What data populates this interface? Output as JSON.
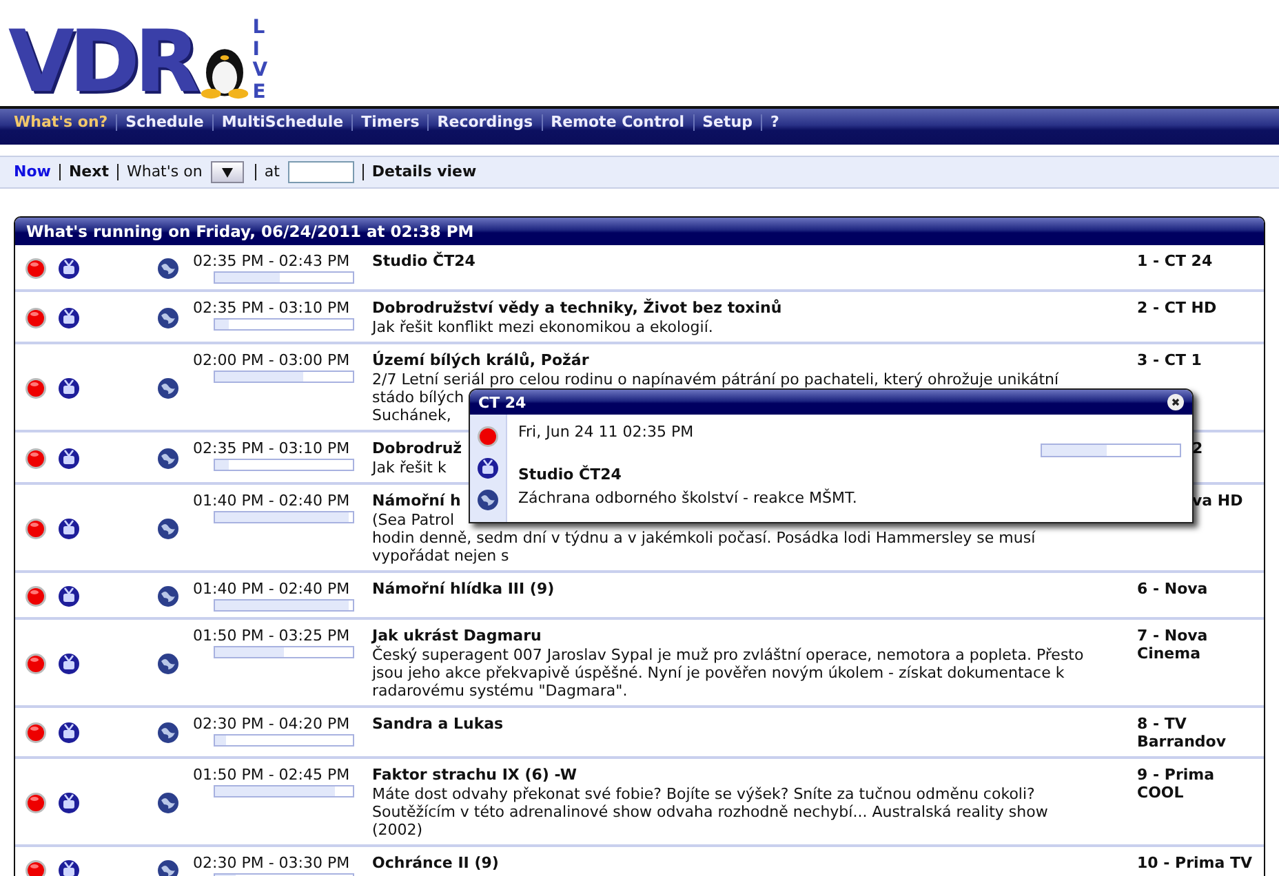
{
  "logo": {
    "text": "VDR",
    "side": "LIVE"
  },
  "nav": [
    {
      "label": "What's on?",
      "selected": true
    },
    {
      "label": "Schedule",
      "selected": false
    },
    {
      "label": "MultiSchedule",
      "selected": false
    },
    {
      "label": "Timers",
      "selected": false
    },
    {
      "label": "Recordings",
      "selected": false
    },
    {
      "label": "Remote Control",
      "selected": false
    },
    {
      "label": "Setup",
      "selected": false
    },
    {
      "label": "?",
      "selected": false
    }
  ],
  "subnav": {
    "links": [
      {
        "label": "Now",
        "selected": true
      },
      {
        "label": "Next",
        "selected": false
      }
    ],
    "whats_on_label": "What's on",
    "at_label": "at",
    "details_view": "Details view"
  },
  "table": {
    "title": "What's running on Friday, 06/24/2011 at 02:38 PM",
    "rows": [
      {
        "time": "02:35 PM - 02:43 PM",
        "level": 0.47,
        "title": "Studio ČT24",
        "lines": [],
        "channel": "1 - CT 24"
      },
      {
        "time": "02:35 PM - 03:10 PM",
        "level": 0.1,
        "title": "Dobrodružství vědy a techniky, Život bez toxinů",
        "lines": [
          "Jak řešit konflikt mezi ekonomikou a ekologií."
        ],
        "channel": "2 - CT HD"
      },
      {
        "time": "02:00 PM - 03:00 PM",
        "level": 0.64,
        "title": "Území bílých králů, Požár",
        "lines": [
          "2/7 Letní seriál pro celou rodinu o napínavém pátrání po pachateli, který ohrožuje unikátní",
          "stádo bílých",
          "Suchánek,"
        ],
        "channel": "3 - CT 1"
      },
      {
        "time": "02:35 PM - 03:10 PM",
        "level": 0.1,
        "title": "Dobrodruž",
        "lines": [
          "Jak řešit k"
        ],
        "channel": "2"
      },
      {
        "time": "01:40 PM - 02:40 PM",
        "level": 0.97,
        "title": "Námořní h",
        "lines": [
          "(Sea Patrol",
          "hodin denně, sedm dní v týdnu a v jakémkoli počasí. Posádka lodi Hammersley se musí",
          "vypořádat nejen s"
        ],
        "channel": "va HD"
      },
      {
        "time": "01:40 PM - 02:40 PM",
        "level": 0.97,
        "title": "Námořní hlídka III (9)",
        "lines": [],
        "channel": "6 - Nova"
      },
      {
        "time": "01:50 PM - 03:25 PM",
        "level": 0.5,
        "title": "Jak ukrást Dagmaru",
        "lines": [
          "Český superagent 007 Jaroslav Sypal je muž pro zvláštní operace, nemotora a popleta. Přesto",
          "jsou jeho akce překvapivě úspěšné. Nyní je pověřen novým úkolem - získat dokumentace k",
          "radarovému systému \"Dagmara\"."
        ],
        "channel": "7 - Nova Cinema"
      },
      {
        "time": "02:30 PM - 04:20 PM",
        "level": 0.08,
        "title": "Sandra a Lukas",
        "lines": [],
        "channel": "8 - TV Barrandov"
      },
      {
        "time": "01:50 PM - 02:45 PM",
        "level": 0.87,
        "title": "Faktor strachu IX (6) -W",
        "lines": [
          "Máte dost odvahy překonat své fobie? Bojíte se výšek? Sníte za tučnou odměnu cokoli?",
          "Soutěžícím v této adrenalinové show odvaha rozhodně nechybí... Australská reality show",
          "(2002)"
        ],
        "channel": "9 - Prima COOL"
      },
      {
        "time": "02:30 PM - 03:30 PM",
        "level": 0.15,
        "title": "Ochránce II (9)",
        "lines": [],
        "channel": "10 - Prima TV"
      }
    ]
  },
  "popup": {
    "title": "CT 24",
    "date": "Fri, Jun 24 11 02:35 PM",
    "level": 0.47,
    "show": "Studio ČT24",
    "description": "Záchrana odborného školství - reakce MŠMT."
  }
}
